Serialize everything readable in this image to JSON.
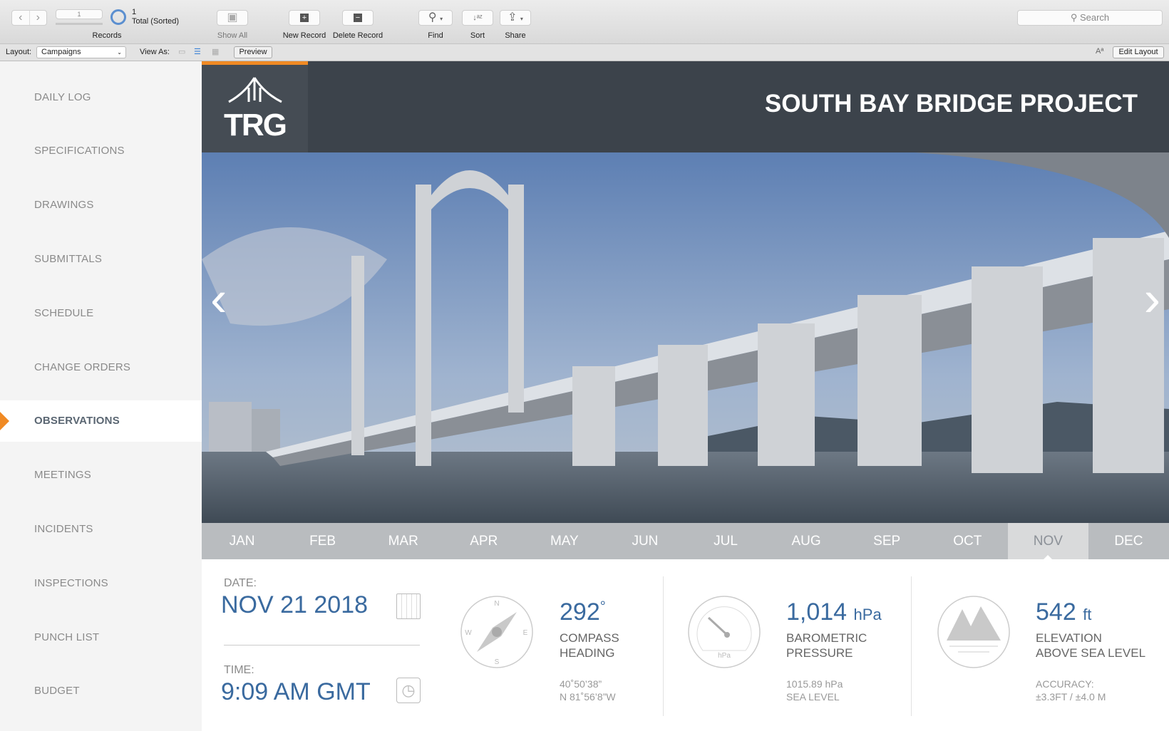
{
  "toolbar": {
    "record_number": "1",
    "found_count": "1",
    "total_label": "Total (Sorted)",
    "records_label": "Records",
    "show_all": "Show All",
    "new_record": "New Record",
    "delete_record": "Delete Record",
    "find": "Find",
    "sort": "Sort",
    "share": "Share",
    "search_placeholder": "Search"
  },
  "layoutbar": {
    "layout_label": "Layout:",
    "layout_value": "Campaigns",
    "view_as_label": "View As:",
    "preview": "Preview",
    "edit_layout": "Edit Layout",
    "font_icon_text": "Aª"
  },
  "sidebar": {
    "items": [
      {
        "label": "DAILY LOG"
      },
      {
        "label": "SPECIFICATIONS"
      },
      {
        "label": "DRAWINGS"
      },
      {
        "label": "SUBMITTALS"
      },
      {
        "label": "SCHEDULE"
      },
      {
        "label": "CHANGE ORDERS"
      },
      {
        "label": "OBSERVATIONS",
        "active": true
      },
      {
        "label": "MEETINGS"
      },
      {
        "label": "INCIDENTS"
      },
      {
        "label": "INSPECTIONS"
      },
      {
        "label": "PUNCH LIST"
      },
      {
        "label": "BUDGET"
      }
    ]
  },
  "header": {
    "logo_text": "TRG",
    "title": "SOUTH BAY BRIDGE PROJECT"
  },
  "months": {
    "items": [
      "JAN",
      "FEB",
      "MAR",
      "APR",
      "MAY",
      "JUN",
      "JUL",
      "AUG",
      "SEP",
      "OCT",
      "NOV",
      "DEC"
    ],
    "selected": "NOV"
  },
  "details": {
    "date_label": "DATE:",
    "date_value": "NOV 21 2018",
    "time_label": "TIME:",
    "time_value": "9:09 AM GMT",
    "compass": {
      "value": "292",
      "unit": "°",
      "label1": "COMPASS",
      "label2": "HEADING",
      "sub1": "40˚50’38”",
      "sub2": "N 81˚56’8”W",
      "n": "N",
      "e": "E",
      "s": "S",
      "w": "W"
    },
    "pressure": {
      "value": "1,014",
      "unit": "hPa",
      "label1": "BAROMETRIC",
      "label2": "PRESSURE",
      "sub1": "1015.89 hPa",
      "sub2": "SEA LEVEL",
      "gauge_unit": "hPa"
    },
    "elevation": {
      "value": "542",
      "unit": "ft",
      "label1": "ELEVATION",
      "label2": "ABOVE SEA LEVEL",
      "sub1": "ACCURACY:",
      "sub2": "±3.3FT / ±4.0 M"
    }
  },
  "colors": {
    "accent": "#f08a24",
    "value_blue": "#3a6a9f",
    "header_bg": "#3c434b"
  }
}
